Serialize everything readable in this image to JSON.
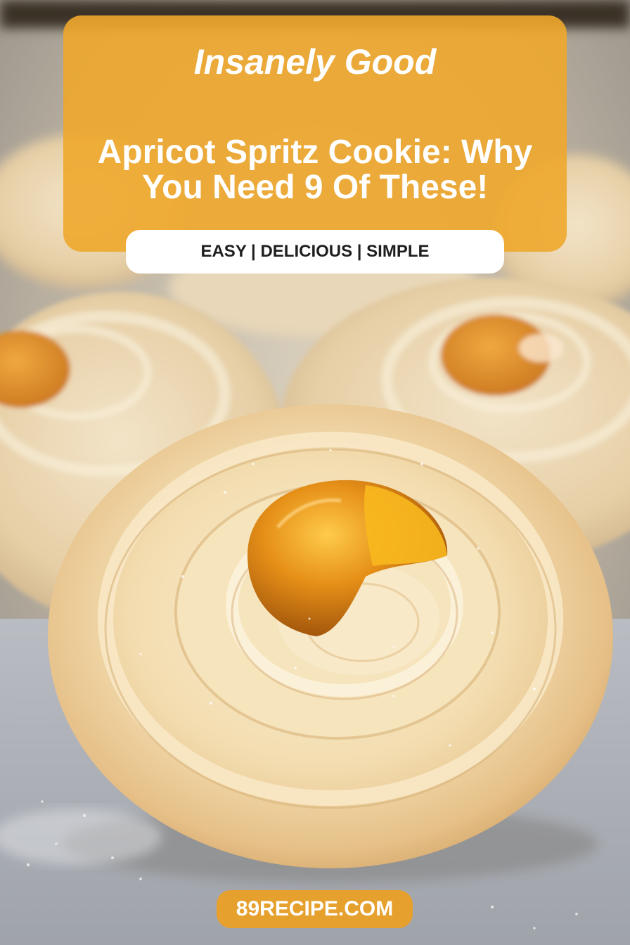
{
  "image": {
    "subject": "apricot-spritz-cookies-photo"
  },
  "banner": {
    "brand": "Insanely Good",
    "title": "Apricot Spritz Cookie: Why You Need 9 Of These!",
    "color": "#EEA72C"
  },
  "tagline": {
    "text": "EASY | DELICIOUS | SIMPLE"
  },
  "footer": {
    "site": "89RECIPE.COM",
    "color": "#E8A028"
  }
}
